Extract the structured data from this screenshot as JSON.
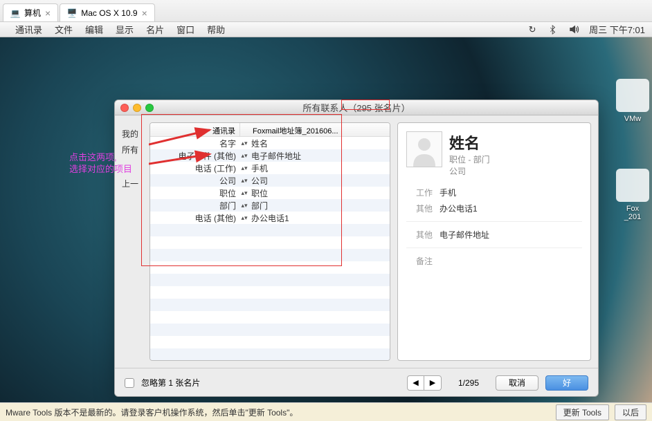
{
  "tabs": {
    "tab1": {
      "label": "算机"
    },
    "tab2": {
      "label": "Mac OS X 10.9"
    }
  },
  "menubar": {
    "items": [
      "通讯录",
      "文件",
      "编辑",
      "显示",
      "名片",
      "窗口",
      "帮助"
    ],
    "clock": "周三 下午7:01"
  },
  "desktop_icons": {
    "icon1": "VMw",
    "icon2": "Fox\n_201"
  },
  "annotation": {
    "line1": "点击这两项,",
    "line2": "选择对应的项目"
  },
  "dialog": {
    "title": "所有联系人（295 张名片）",
    "sidebar_sliver": [
      "我的",
      "所有",
      "上一"
    ],
    "header_left": "通讯录",
    "header_right": "Foxmail地址簿_201606...",
    "rows": [
      {
        "label": "名字",
        "value": "姓名"
      },
      {
        "label": "电子邮件 (其他)",
        "value": "电子邮件地址"
      },
      {
        "label": "电话 (工作)",
        "value": "手机"
      },
      {
        "label": "公司",
        "value": "公司"
      },
      {
        "label": "职位",
        "value": "职位"
      },
      {
        "label": "部门",
        "value": "部门"
      },
      {
        "label": "电话 (其他)",
        "value": "办公电话1"
      }
    ],
    "preview": {
      "name": "姓名",
      "subtitle1": "职位 - 部门",
      "subtitle2": "公司",
      "fields": [
        {
          "k": "工作",
          "v": "手机"
        },
        {
          "k": "其他",
          "v": "办公电话1"
        }
      ],
      "fields2": [
        {
          "k": "其他",
          "v": "电子邮件地址"
        }
      ],
      "note_label": "备注"
    },
    "footer": {
      "skip_label": "忽略第 1 张名片",
      "page": "1/295",
      "cancel": "取消",
      "ok": "好"
    }
  },
  "statusbar": {
    "text": "Mware Tools 版本不是最新的。请登录客户机操作系统，然后单击\"更新 Tools\"。",
    "btn1": "更新 Tools",
    "btn2": "以后"
  }
}
